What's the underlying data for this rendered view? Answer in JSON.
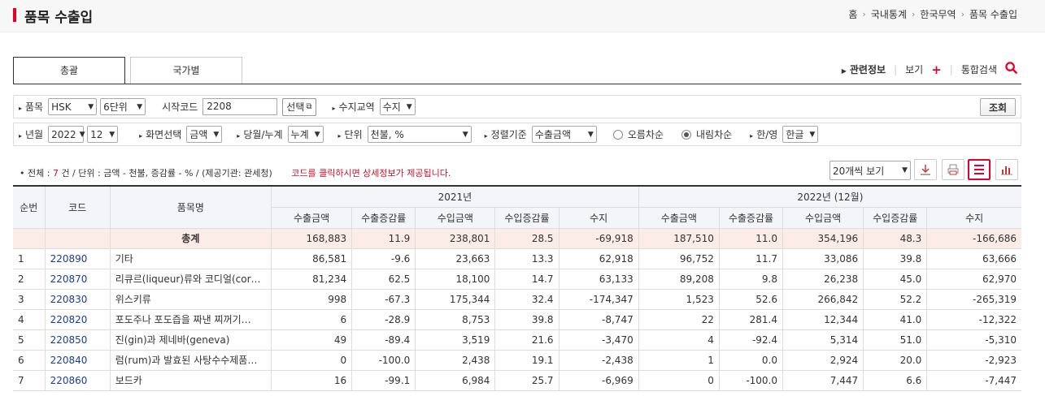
{
  "page": {
    "title": "품목 수출입"
  },
  "breadcrumb": [
    "홈",
    "국내통계",
    "한국무역",
    "품목 수출입"
  ],
  "tabs": [
    {
      "label": "총괄",
      "active": true
    },
    {
      "label": "국가별",
      "active": false
    }
  ],
  "related": {
    "info": "관련정보",
    "view": "보기",
    "search": "통합검색"
  },
  "filters": {
    "item_label": "품목",
    "item_class": "HSK",
    "item_unit": "6단위",
    "start_code_label": "시작코드",
    "start_code": "2208",
    "select_btn": "선택",
    "trade_label": "수지교역",
    "trade_value": "수지",
    "query_btn": "조회",
    "ym_label": "년월",
    "year": "2022",
    "month": "12",
    "screen_label": "화면선택",
    "screen_value": "금액",
    "period_label": "당월/누계",
    "period_value": "누계",
    "unit_label": "단위",
    "unit_value": "천불, %",
    "sort_label": "정렬기준",
    "sort_value": "수출금액",
    "asc_label": "오름차순",
    "desc_label": "내림차순",
    "lang_label": "한/영",
    "lang_value": "한글"
  },
  "summary": {
    "total_prefix": "• 전체 :",
    "total_count": "7",
    "total_suffix": "건 / 단위 : 금액 - 천불, 증감률 - % / (제공기관: 관세청)",
    "notice": "코드를 클릭하시면 상세정보가 제공됩니다."
  },
  "view_option": "20개씩 보기",
  "table": {
    "headers": {
      "no": "순번",
      "code": "코드",
      "name": "품목명",
      "group1": "2021년",
      "group2": "2022년 (12월)",
      "cols": [
        "수출금액",
        "수출증감률",
        "수입금액",
        "수입증감률",
        "수지",
        "수출금액",
        "수출증감률",
        "수입금액",
        "수입증감률",
        "수지"
      ]
    },
    "total": {
      "label": "총계",
      "values": [
        "168,883",
        "11.9",
        "238,801",
        "28.5",
        "-69,918",
        "187,510",
        "11.0",
        "354,196",
        "48.3",
        "-166,686"
      ]
    },
    "rows": [
      {
        "no": "1",
        "code": "220890",
        "name": "기타",
        "values": [
          "86,581",
          "-9.6",
          "23,663",
          "13.3",
          "62,918",
          "96,752",
          "11.7",
          "33,086",
          "39.8",
          "63,666"
        ]
      },
      {
        "no": "2",
        "code": "220870",
        "name": "리큐르(liqueur)류와 코디얼(cor…",
        "values": [
          "81,234",
          "62.5",
          "18,100",
          "14.7",
          "63,133",
          "89,208",
          "9.8",
          "26,238",
          "45.0",
          "62,970"
        ]
      },
      {
        "no": "3",
        "code": "220830",
        "name": "위스키류",
        "values": [
          "998",
          "-67.3",
          "175,344",
          "32.4",
          "-174,347",
          "1,523",
          "52.6",
          "266,842",
          "52.2",
          "-265,319"
        ]
      },
      {
        "no": "4",
        "code": "220820",
        "name": "포도주나 포도즙을 짜낸 찌꺼기…",
        "values": [
          "6",
          "-28.9",
          "8,753",
          "39.8",
          "-8,747",
          "22",
          "281.4",
          "12,344",
          "41.0",
          "-12,322"
        ]
      },
      {
        "no": "5",
        "code": "220850",
        "name": "진(gin)과 제네바(geneva)",
        "values": [
          "49",
          "-89.4",
          "3,519",
          "21.6",
          "-3,470",
          "4",
          "-92.4",
          "5,314",
          "51.0",
          "-5,310"
        ]
      },
      {
        "no": "6",
        "code": "220840",
        "name": "럼(rum)과 발효된 사탕수수제품…",
        "values": [
          "0",
          "-100.0",
          "2,438",
          "19.1",
          "-2,438",
          "1",
          "0.0",
          "2,924",
          "20.0",
          "-2,923"
        ]
      },
      {
        "no": "7",
        "code": "220860",
        "name": "보드카",
        "values": [
          "16",
          "-99.1",
          "6,984",
          "25.7",
          "-6,969",
          "0",
          "-100.0",
          "7,447",
          "6.6",
          "-7,447"
        ]
      }
    ]
  }
}
